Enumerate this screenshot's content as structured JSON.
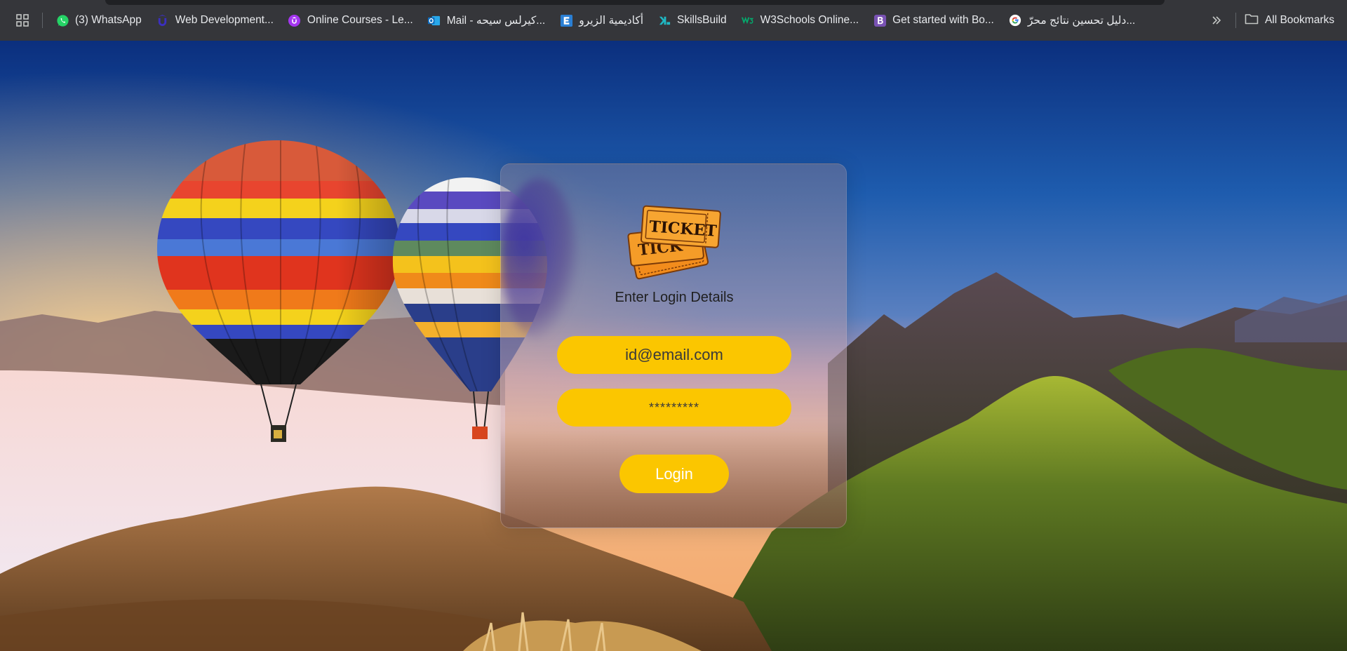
{
  "bookmarks_bar": {
    "items": [
      {
        "label": "(3) WhatsApp",
        "icon": "whatsapp-icon",
        "color": "#25d366"
      },
      {
        "label": "Web Development...",
        "icon": "udemy-icon",
        "color": "#3b2fbf"
      },
      {
        "label": "Online Courses - Le...",
        "icon": "udemy-icon",
        "color": "#a435f0"
      },
      {
        "label": "Mail - كيرلس سيحه...",
        "icon": "outlook-icon",
        "color": "#0f6cbd"
      },
      {
        "label": "أكاديمية الزيرو",
        "icon": "e-icon",
        "color": "#2a7fd4"
      },
      {
        "label": "SkillsBuild",
        "icon": "skillsbuild-icon",
        "color": "#1fb8c4"
      },
      {
        "label": "W3Schools Online...",
        "icon": "w3schools-icon",
        "color": "#04aa6d"
      },
      {
        "label": "Get started with Bo...",
        "icon": "bootstrap-icon",
        "color": "#7952b3"
      },
      {
        "label": "دليل تحسين نتائج محرّ...",
        "icon": "google-icon",
        "color": "#ffffff"
      }
    ],
    "all_bookmarks_label": "All Bookmarks"
  },
  "login": {
    "title": "Enter Login Details",
    "email_value": "id@email.com",
    "password_value": "*********",
    "button_label": "Login",
    "accent_color": "#fbc600"
  }
}
